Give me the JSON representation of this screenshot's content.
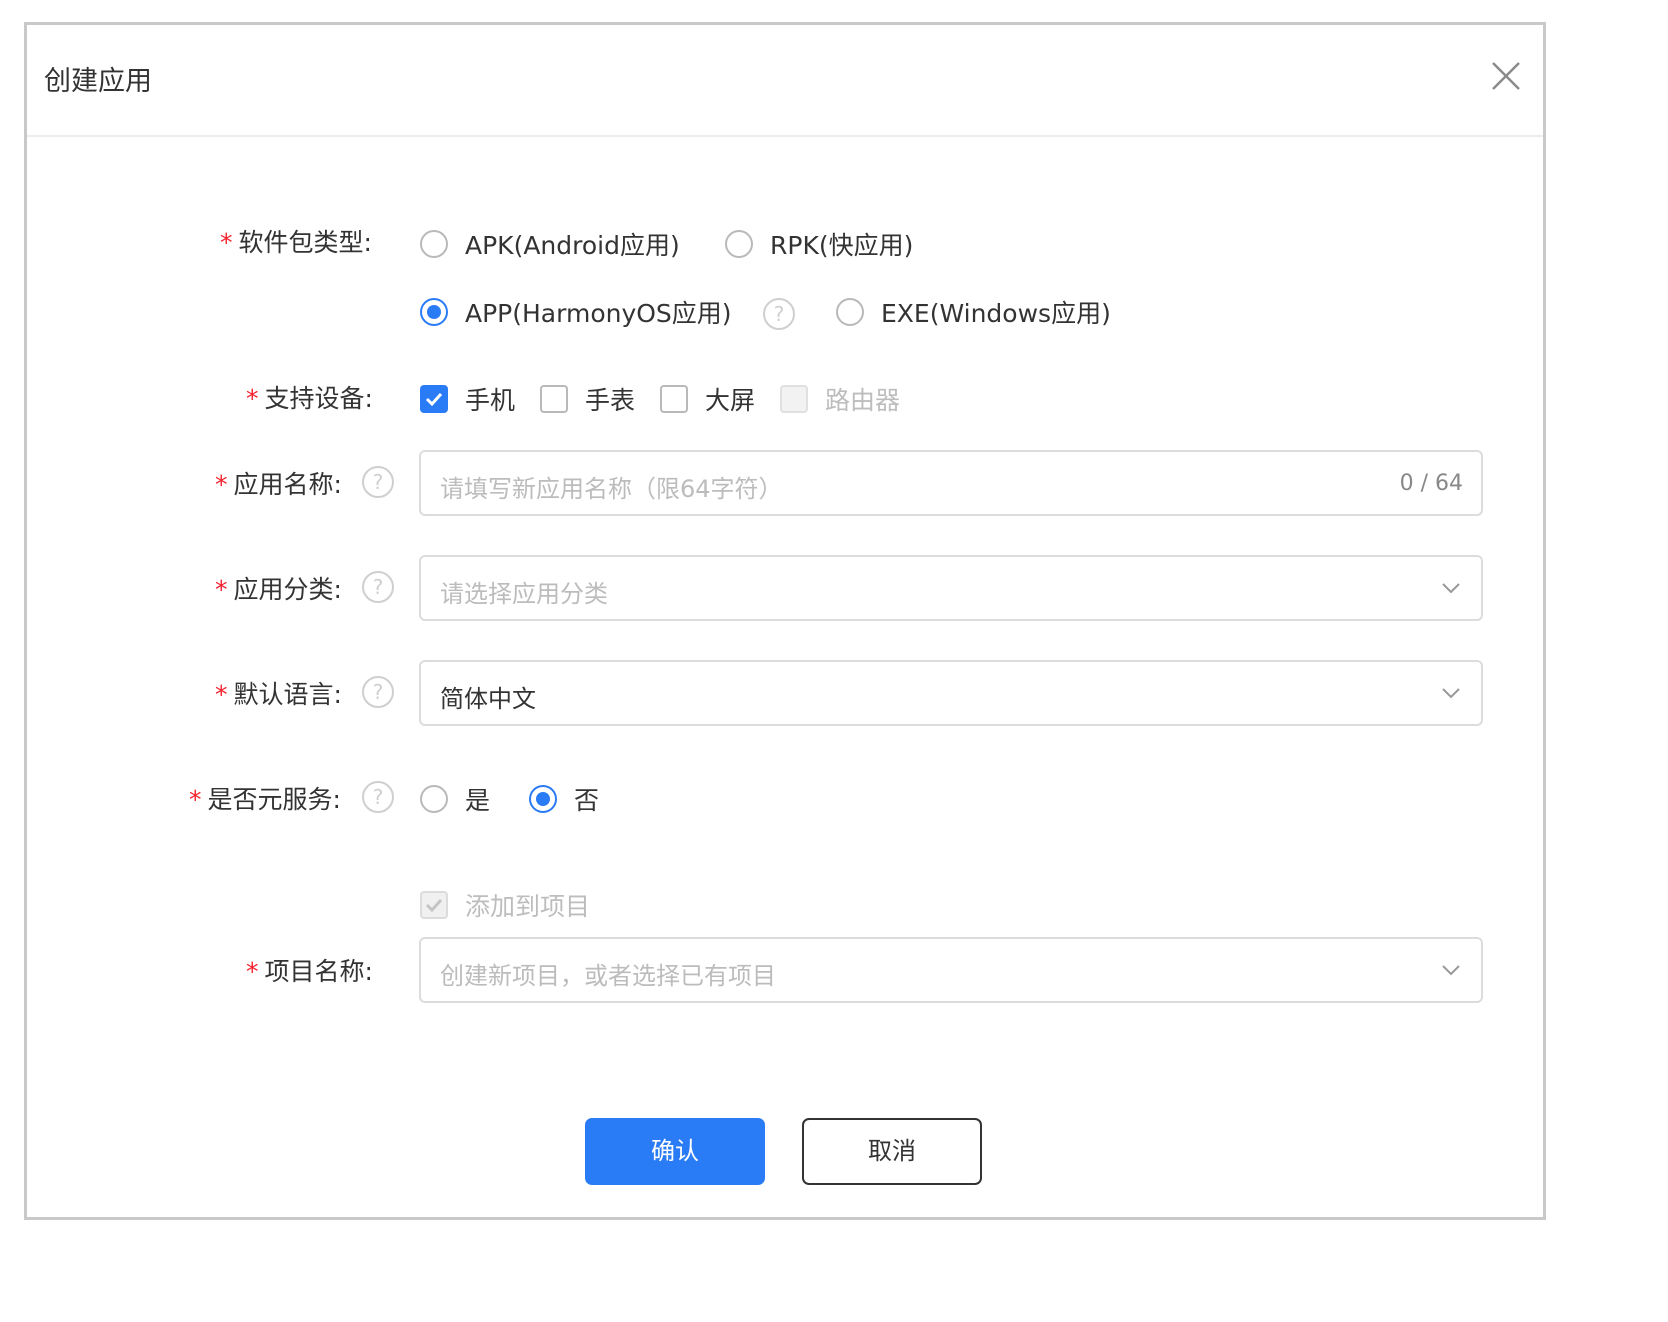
{
  "dialog": {
    "title": "创建应用"
  },
  "form": {
    "package_type": {
      "label": "软件包类型:",
      "options": [
        {
          "label": "APK(Android应用)",
          "selected": false
        },
        {
          "label": "RPK(快应用)",
          "selected": false
        },
        {
          "label": "APP(HarmonyOS应用)",
          "selected": true
        },
        {
          "label": "EXE(Windows应用)",
          "selected": false
        }
      ]
    },
    "devices": {
      "label": "支持设备:",
      "options": [
        {
          "label": "手机",
          "checked": true,
          "disabled": false
        },
        {
          "label": "手表",
          "checked": false,
          "disabled": false
        },
        {
          "label": "大屏",
          "checked": false,
          "disabled": false
        },
        {
          "label": "路由器",
          "checked": false,
          "disabled": true
        }
      ]
    },
    "app_name": {
      "label": "应用名称:",
      "placeholder": "请填写新应用名称（限64字符）",
      "counter": "0 / 64"
    },
    "app_category": {
      "label": "应用分类:",
      "placeholder": "请选择应用分类"
    },
    "default_language": {
      "label": "默认语言:",
      "value": "简体中文"
    },
    "meta_service": {
      "label": "是否元服务:",
      "options": [
        {
          "label": "是",
          "selected": false
        },
        {
          "label": "否",
          "selected": true
        }
      ]
    },
    "add_to_project": {
      "label": "添加到项目",
      "checked": true,
      "disabled": true
    },
    "project_name": {
      "label": "项目名称:",
      "placeholder": "创建新项目，或者选择已有项目"
    },
    "required_mark": "*"
  },
  "buttons": {
    "confirm": "确认",
    "cancel": "取消"
  },
  "colors": {
    "primary": "#2a7cf6",
    "required": "#f5222d"
  },
  "icons": {
    "close": "close-icon",
    "help": "question-circle-icon",
    "dropdown": "chevron-down-icon",
    "check": "check-icon"
  }
}
